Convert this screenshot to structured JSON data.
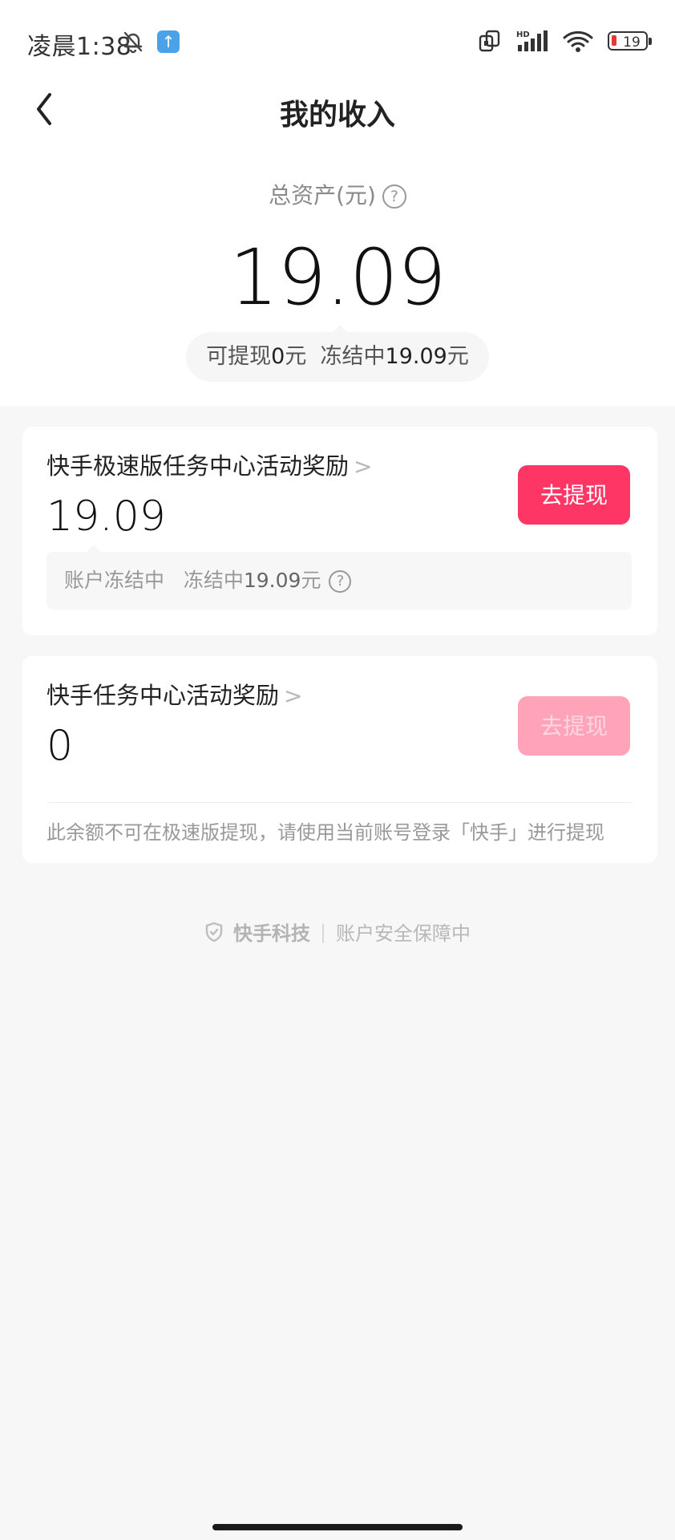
{
  "status_bar": {
    "time": "凌晨1:38",
    "battery": "19"
  },
  "nav": {
    "title": "我的收入"
  },
  "summary": {
    "label": "总资产(元)",
    "amount": "19.09",
    "withdrawable_label": "可提现",
    "withdrawable_value": "0",
    "withdrawable_unit": "元",
    "frozen_label": "冻结中",
    "frozen_value": "19.09",
    "frozen_unit": "元"
  },
  "cards": [
    {
      "title": "快手极速版任务中心活动奖励",
      "amount": "19.09",
      "button_label": "去提现",
      "frozen_prefix": "账户冻结中",
      "frozen_label": "冻结中",
      "frozen_value": "19.09",
      "frozen_unit": "元"
    },
    {
      "title": "快手任务中心活动奖励",
      "amount": "0",
      "button_label": "去提现",
      "note": "此余额不可在极速版提现，请使用当前账号登录「快手」进行提现"
    }
  ],
  "footer": {
    "brand": "快手科技",
    "text": "账户安全保障中"
  },
  "colors": {
    "accent": "#fe3666",
    "accent_disabled": "#ffa4b8"
  }
}
